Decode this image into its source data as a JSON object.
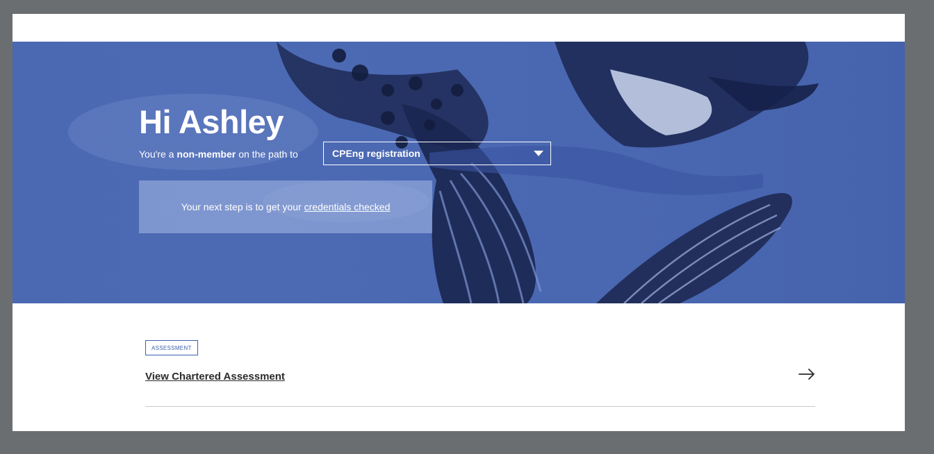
{
  "greeting": {
    "title": "Hi Ashley"
  },
  "status": {
    "prefix": "You're a",
    "member_type": "non-member",
    "suffix": "on the path to"
  },
  "path_select": {
    "selected": "CPEng registration"
  },
  "next_step": {
    "text": "Your next step is to get your",
    "link": "credentials checked"
  },
  "assessment": {
    "badge": "ASSESSMENT",
    "link": "View Chartered Assessment"
  },
  "colors": {
    "hero_blue": "#4b69b3",
    "page_bg": "#ffffff",
    "outer_bg": "#6b6e70",
    "accent_blue": "#3a5fae"
  },
  "icons": {
    "select_caret": "caret-down-icon",
    "row_arrow": "arrow-right-icon"
  }
}
